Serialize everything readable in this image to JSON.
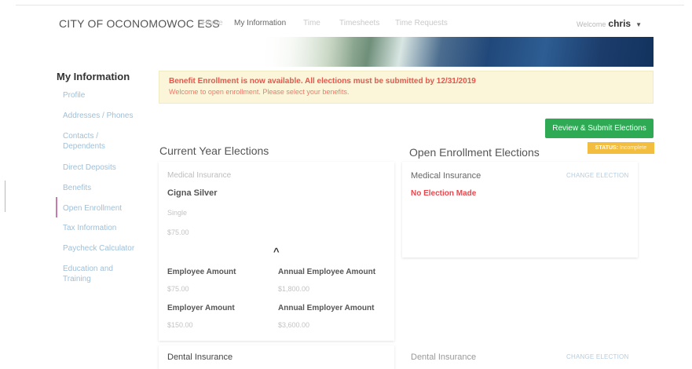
{
  "header": {
    "brand": "CITY OF OCONOMOWOC ESS",
    "nav": [
      {
        "label": "Home",
        "active": false
      },
      {
        "label": "My Information",
        "active": true
      },
      {
        "label": "Time",
        "active": false
      },
      {
        "label": "Timesheets",
        "active": false
      },
      {
        "label": "Time Requests",
        "active": false
      }
    ],
    "user_prefix": "Welcome",
    "user_name": "chris"
  },
  "sidebar": {
    "title": "My Information",
    "items": [
      {
        "label": "Profile"
      },
      {
        "label": "Addresses / Phones"
      },
      {
        "label": "Contacts / Dependents"
      },
      {
        "label": "Direct Deposits"
      },
      {
        "label": "Benefits"
      },
      {
        "label": "Open Enrollment",
        "active": true
      },
      {
        "label": "Tax Information"
      },
      {
        "label": "Paycheck Calculator"
      },
      {
        "label": "Education and Training"
      }
    ]
  },
  "alert": {
    "headline": "Benefit Enrollment is now available. All elections must be submitted by 12/31/2019",
    "message": "Welcome to open enrollment. Please select your benefits."
  },
  "actions": {
    "review_submit": "Review & Submit Elections"
  },
  "current": {
    "heading": "Current Year Elections",
    "medical": {
      "category": "Medical Insurance",
      "plan": "Cigna Silver",
      "coverage": "Single",
      "cost": "$75.00",
      "employee_amount_label": "Employee Amount",
      "employee_amount": "$75.00",
      "annual_employee_amount_label": "Annual Employee Amount",
      "annual_employee_amount": "$1,800.00",
      "employer_amount_label": "Employer Amount",
      "employer_amount": "$150.00",
      "annual_employer_amount_label": "Annual Employer Amount",
      "annual_employer_amount": "$3,600.00"
    },
    "dental": {
      "category": "Dental Insurance"
    }
  },
  "open": {
    "heading": "Open Enrollment Elections",
    "status_label": "STATUS:",
    "status_value": "Incomplete",
    "medical": {
      "category": "Medical Insurance",
      "change_link": "CHANGE ELECTION",
      "election_status": "No Election Made"
    },
    "dental": {
      "category": "Dental Insurance",
      "change_link": "CHANGE ELECTION"
    }
  },
  "colors": {
    "accent_green": "#2eaa55",
    "alert_red": "#e8554a",
    "status_orange": "#f3be3f",
    "link_blue": "#9ec0da"
  }
}
